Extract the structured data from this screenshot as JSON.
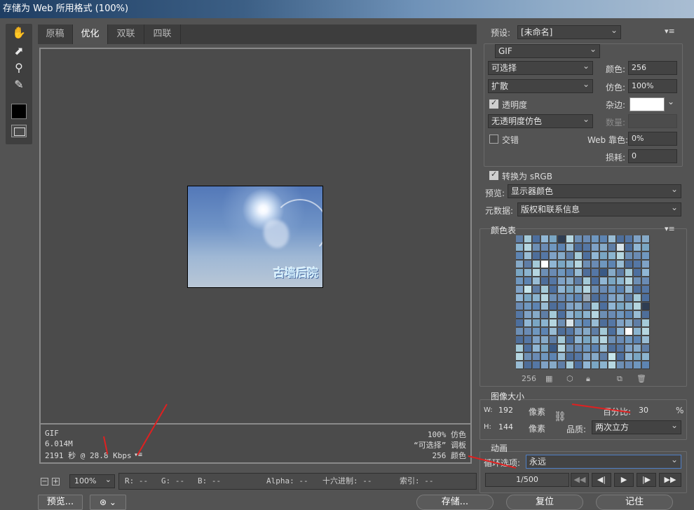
{
  "window": {
    "title": "存储为 Web 所用格式 (100%)"
  },
  "tabs": [
    {
      "label": "原稿"
    },
    {
      "label": "优化"
    },
    {
      "label": "双联"
    },
    {
      "label": "四联"
    }
  ],
  "active_tab": "优化",
  "preview_image": {
    "watermark": "古墙后院"
  },
  "info": {
    "format": "GIF",
    "size": "6.014M",
    "time": "2191 秒 @ 28.8 Kbps",
    "dither_info": "100% 仿色",
    "palette_info": "“可选择” 调板",
    "colors_info": "256 颜色"
  },
  "status": {
    "zoom": "100%",
    "r": "R: --",
    "g": "G: --",
    "b": "B: --",
    "alpha": "Alpha: --",
    "hex": "十六进制: --",
    "index": "索引: --"
  },
  "buttons": {
    "preview": "预览...",
    "save": "存储...",
    "reset": "复位",
    "remember": "记住"
  },
  "settings": {
    "preset_label": "预设:",
    "preset_value": "[未命名]",
    "format": "GIF",
    "reduction": "可选择",
    "dither_algo": "扩散",
    "colors_label": "颜色:",
    "colors_value": "256",
    "dither_label": "仿色:",
    "dither_value": "100%",
    "transparency_label": "透明度",
    "transparency_checked": true,
    "matte_label": "杂边:",
    "matte_color": "#ffffff",
    "trans_dither": "无透明度仿色",
    "amount_label": "数量:",
    "interlaced_label": "交错",
    "interlaced_checked": false,
    "web_snap_label": "Web 靠色:",
    "web_snap_value": "0%",
    "lossy_label": "损耗:",
    "lossy_value": "0",
    "convert_srgb_label": "转换为 sRGB",
    "convert_srgb_checked": true,
    "preview_label": "预览:",
    "preview_value": "显示器颜色",
    "metadata_label": "元数据:",
    "metadata_value": "版权和联系信息"
  },
  "color_table": {
    "title": "颜色表",
    "count": "256",
    "colors": [
      "#5f7ea6",
      "#6d8fb5",
      "#7fa2c6",
      "#8bb4cf",
      "#4e6e9a",
      "#90b6d4",
      "#5d84b2",
      "#a4cad8",
      "#6a8bb4",
      "#86aac8",
      "#b5d6e0",
      "#5577a5",
      "#7aa6c3",
      "#98bcd4",
      "#4d6f9e",
      "#6f97bf"
    ],
    "image_size_title": "图像大小",
    "w_label": "W:",
    "w_value": "192",
    "h_label": "H:",
    "h_value": "144",
    "unit": "像素",
    "percent_label": "百分比:",
    "percent_value": "30",
    "percent_unit": "%",
    "quality_label": "品质:",
    "quality_value": "两次立方"
  },
  "animation": {
    "title": "动画",
    "loop_label": "循环选项:",
    "loop_value": "永远",
    "frame": "1/500"
  }
}
